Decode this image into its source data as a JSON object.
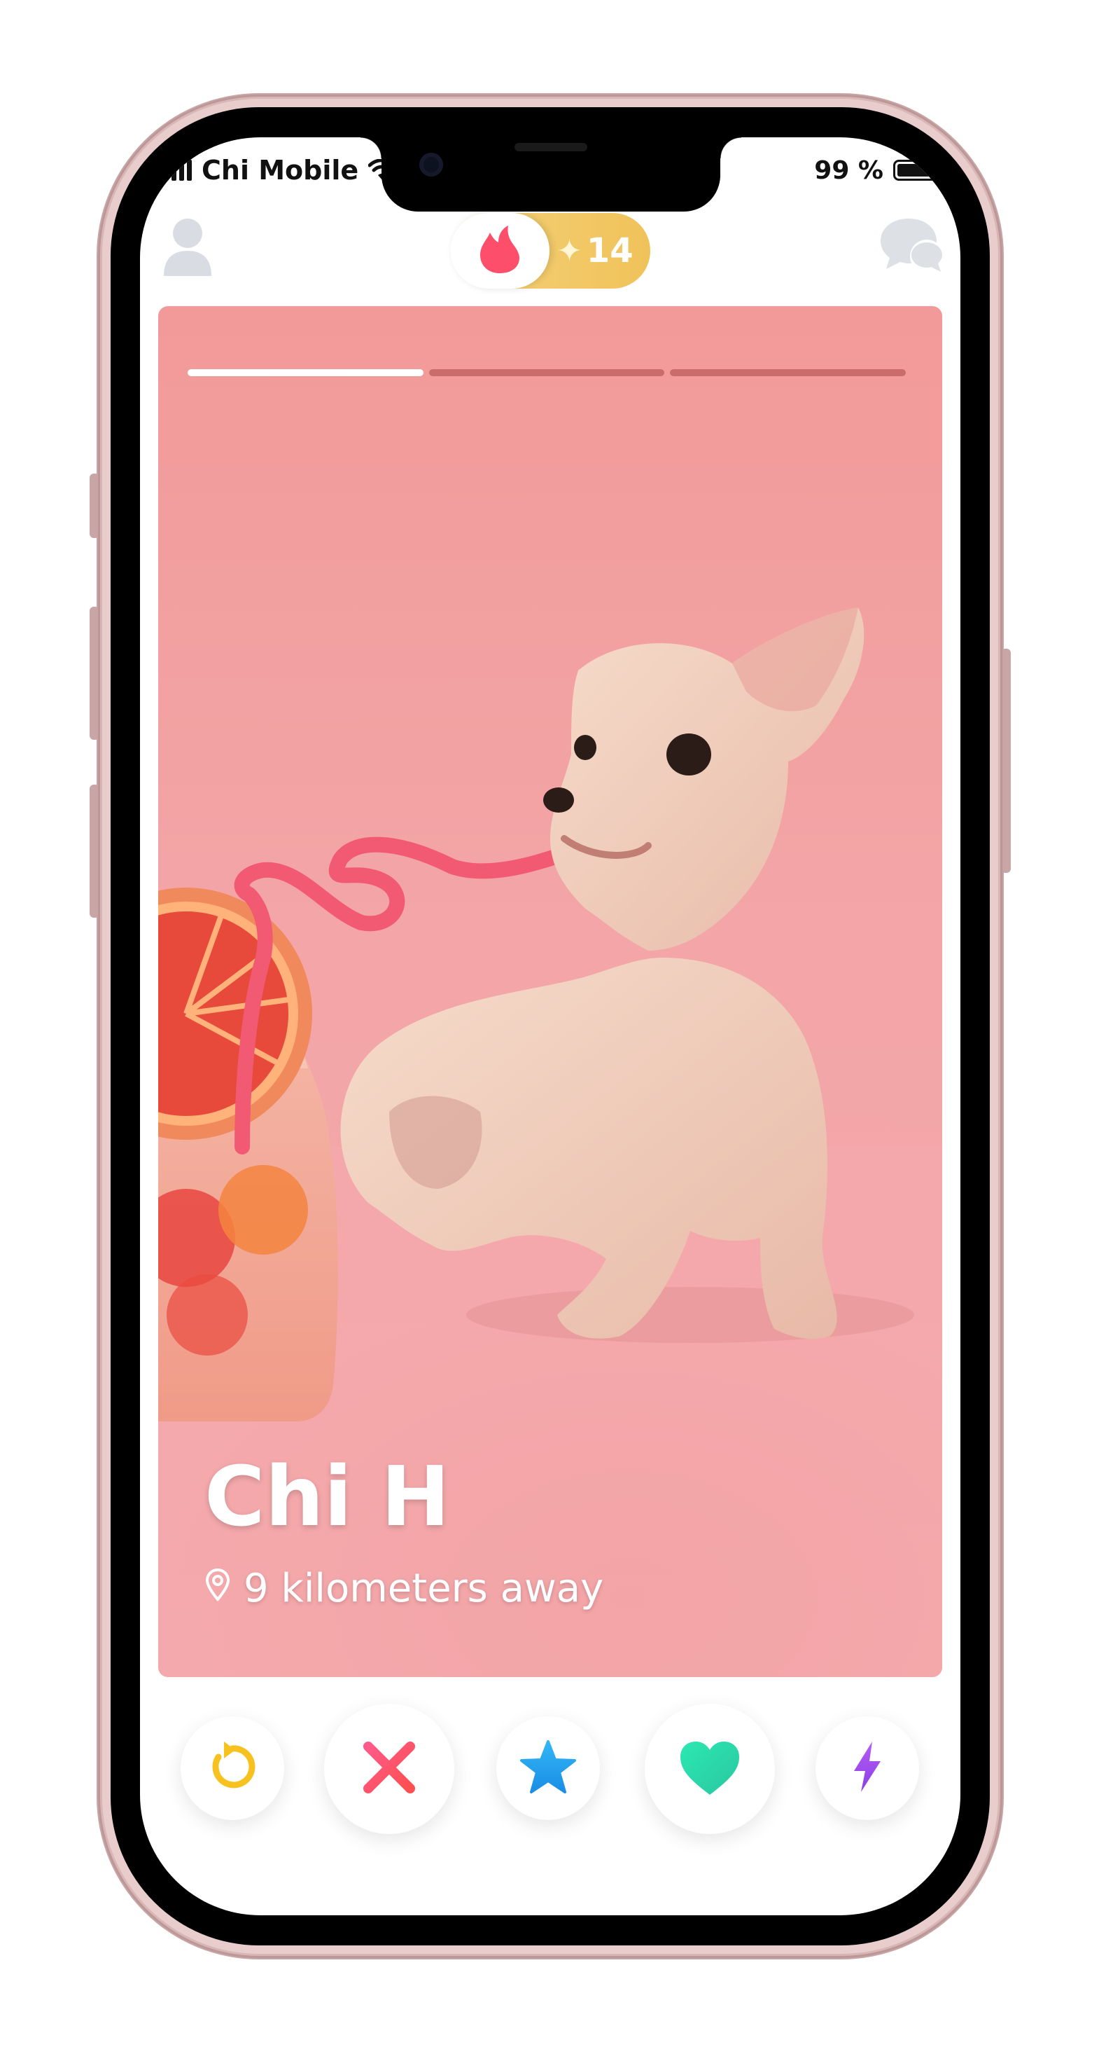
{
  "status_bar": {
    "carrier": "Chi Mobile",
    "battery": "99 %"
  },
  "header": {
    "boost_count": "14"
  },
  "card": {
    "name": "Chi H",
    "distance": "9 kilometers away",
    "photo_count": 3,
    "active_photo_index": 0
  },
  "icons": {
    "profile": "person-icon",
    "logo": "flame-icon",
    "sparkle": "sparkle-icon",
    "chat": "chat-bubbles-icon",
    "location": "location-pin-icon",
    "rewind": "rewind-icon",
    "nope": "x-icon",
    "super_like": "star-icon",
    "like": "heart-icon",
    "boost": "lightning-icon"
  },
  "colors": {
    "brand": "#fd4f6b",
    "rewind": "#f7c21f",
    "nope": "#fd4f6b",
    "super_like": "#1ea1f2",
    "like": "#28dcab",
    "boost": "#a04cf0",
    "gold": "#f0c25a"
  }
}
